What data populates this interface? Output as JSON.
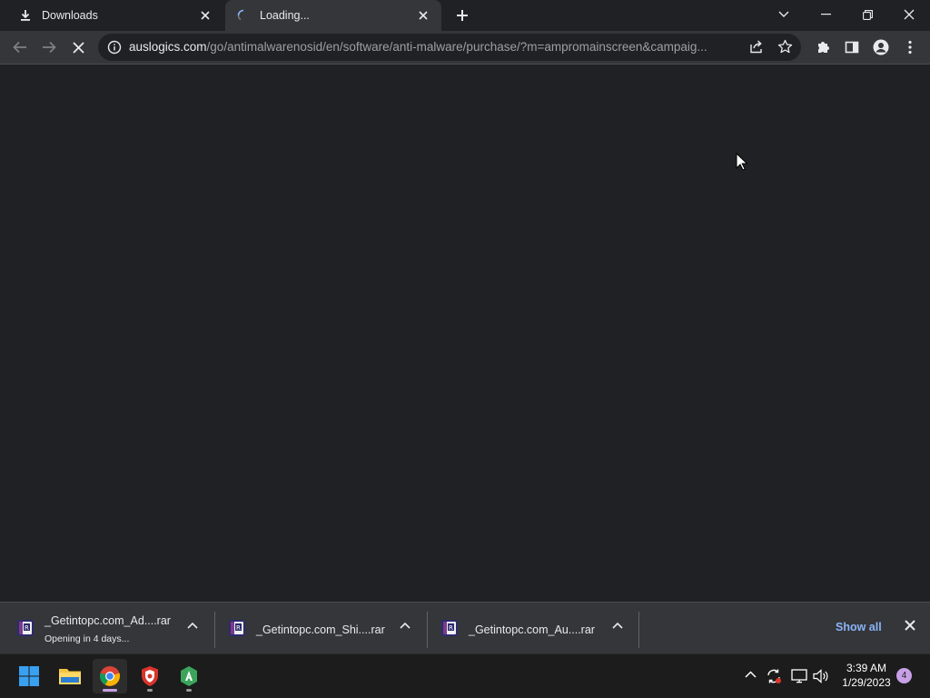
{
  "tabs": [
    {
      "title": "Downloads",
      "icon": "download-icon"
    },
    {
      "title": "Loading...",
      "icon": "loading-spinner-icon"
    }
  ],
  "toolbar": {
    "url_domain": "auslogics.com",
    "url_path": "/go/antimalwarenosid/en/software/anti-malware/purchase/?m=ampromainscreen&campaig..."
  },
  "downloads": [
    {
      "filename": "_Getintopc.com_Ad....rar",
      "status": "Opening in 4 days..."
    },
    {
      "filename": "_Getintopc.com_Shi....rar",
      "status": ""
    },
    {
      "filename": "_Getintopc.com_Au....rar",
      "status": ""
    }
  ],
  "shelf": {
    "show_all": "Show all"
  },
  "taskbar": {
    "apps": [
      "windows-start",
      "file-explorer",
      "google-chrome",
      "antivirus-shield",
      "android-app"
    ],
    "time": "3:39 AM",
    "date": "1/29/2023",
    "notification_count": "4"
  },
  "colors": {
    "background": "#202124",
    "toolbar": "#35363a",
    "link": "#8ab4f8",
    "taskbar": "#1c1c1c"
  }
}
